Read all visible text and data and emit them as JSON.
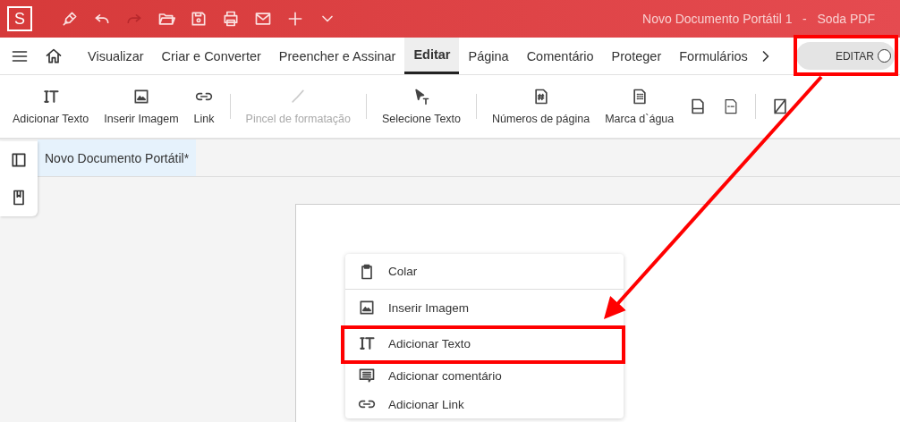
{
  "title_bar": {
    "app_logo": "S",
    "quick_actions": [
      {
        "disabled": false
      },
      {
        "disabled": false
      },
      {
        "disabled": true
      },
      {
        "disabled": false
      },
      {
        "disabled": false
      },
      {
        "disabled": false
      },
      {
        "disabled": false
      },
      {
        "disabled": false
      },
      {
        "disabled": false
      }
    ],
    "title": "Novo Documento Portátil 1   -   Soda PDF"
  },
  "tabs": [
    {
      "label": "Visualizar",
      "selected": false
    },
    {
      "label": "Criar e Converter",
      "selected": false
    },
    {
      "label": "Preencher e Assinar",
      "selected": false
    },
    {
      "label": "Editar",
      "selected": true
    },
    {
      "label": "Página",
      "selected": false
    },
    {
      "label": "Comentário",
      "selected": false
    },
    {
      "label": "Proteger",
      "selected": false
    },
    {
      "label": "Formulários",
      "selected": false
    }
  ],
  "edit_toggle": {
    "label": "EDITAR",
    "on": false
  },
  "toolbar": [
    {
      "kind": "tool",
      "label": "Adicionar Texto",
      "disabled": false
    },
    {
      "kind": "tool",
      "label": "Inserir Imagem",
      "disabled": false
    },
    {
      "kind": "tool",
      "label": "Link",
      "disabled": false
    },
    {
      "kind": "separator"
    },
    {
      "kind": "tool",
      "label": "Pincel de formatação",
      "disabled": true
    },
    {
      "kind": "separator"
    },
    {
      "kind": "tool",
      "label": "Selecione Texto",
      "disabled": false
    },
    {
      "kind": "separator"
    },
    {
      "kind": "tool",
      "label": "Números de página",
      "disabled": false
    },
    {
      "kind": "tool",
      "label": "Marca d`água",
      "disabled": false
    },
    {
      "kind": "icon"
    },
    {
      "kind": "icon"
    },
    {
      "kind": "separator"
    },
    {
      "kind": "icon"
    }
  ],
  "document_tab": {
    "label": "Novo Documento Portátil*",
    "selected": true
  },
  "context_menu": [
    {
      "label": "Colar",
      "divider_after": true
    },
    {
      "label": "Inserir Imagem",
      "divider_after": false
    },
    {
      "label": "Adicionar Texto",
      "divider_after": false
    },
    {
      "label": "Adicionar comentário",
      "divider_after": false
    },
    {
      "label": "Adicionar Link",
      "divider_after": false
    }
  ]
}
